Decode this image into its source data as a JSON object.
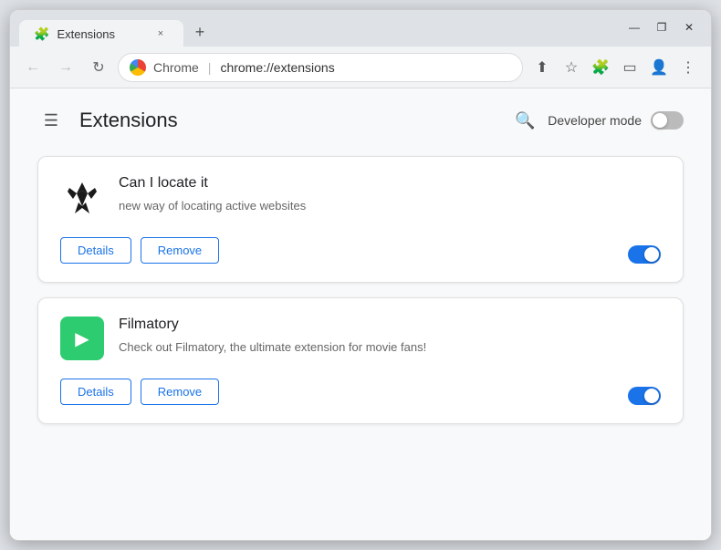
{
  "window": {
    "title": "Extensions",
    "tab_label": "Extensions",
    "tab_close": "×",
    "new_tab": "+",
    "controls": {
      "minimize": "—",
      "maximize": "❐",
      "close": "✕"
    }
  },
  "toolbar": {
    "back_icon": "←",
    "forward_icon": "→",
    "refresh_icon": "↻",
    "chrome_label": "Chrome",
    "address": "chrome://extensions",
    "share_icon": "⬆",
    "bookmark_icon": "☆",
    "extensions_icon": "🧩",
    "sidebar_icon": "▭",
    "profile_icon": "👤",
    "menu_icon": "⋮"
  },
  "page": {
    "hamburger": "☰",
    "title": "Extensions",
    "search_icon": "🔍",
    "dev_mode_label": "Developer mode"
  },
  "extensions": [
    {
      "id": "canlocate",
      "name": "Can I locate it",
      "description": "new way of locating active websites",
      "details_label": "Details",
      "remove_label": "Remove",
      "enabled": true
    },
    {
      "id": "filmatory",
      "name": "Filmatory",
      "description": "Check out Filmatory, the ultimate extension for movie fans!",
      "details_label": "Details",
      "remove_label": "Remove",
      "enabled": true
    }
  ]
}
